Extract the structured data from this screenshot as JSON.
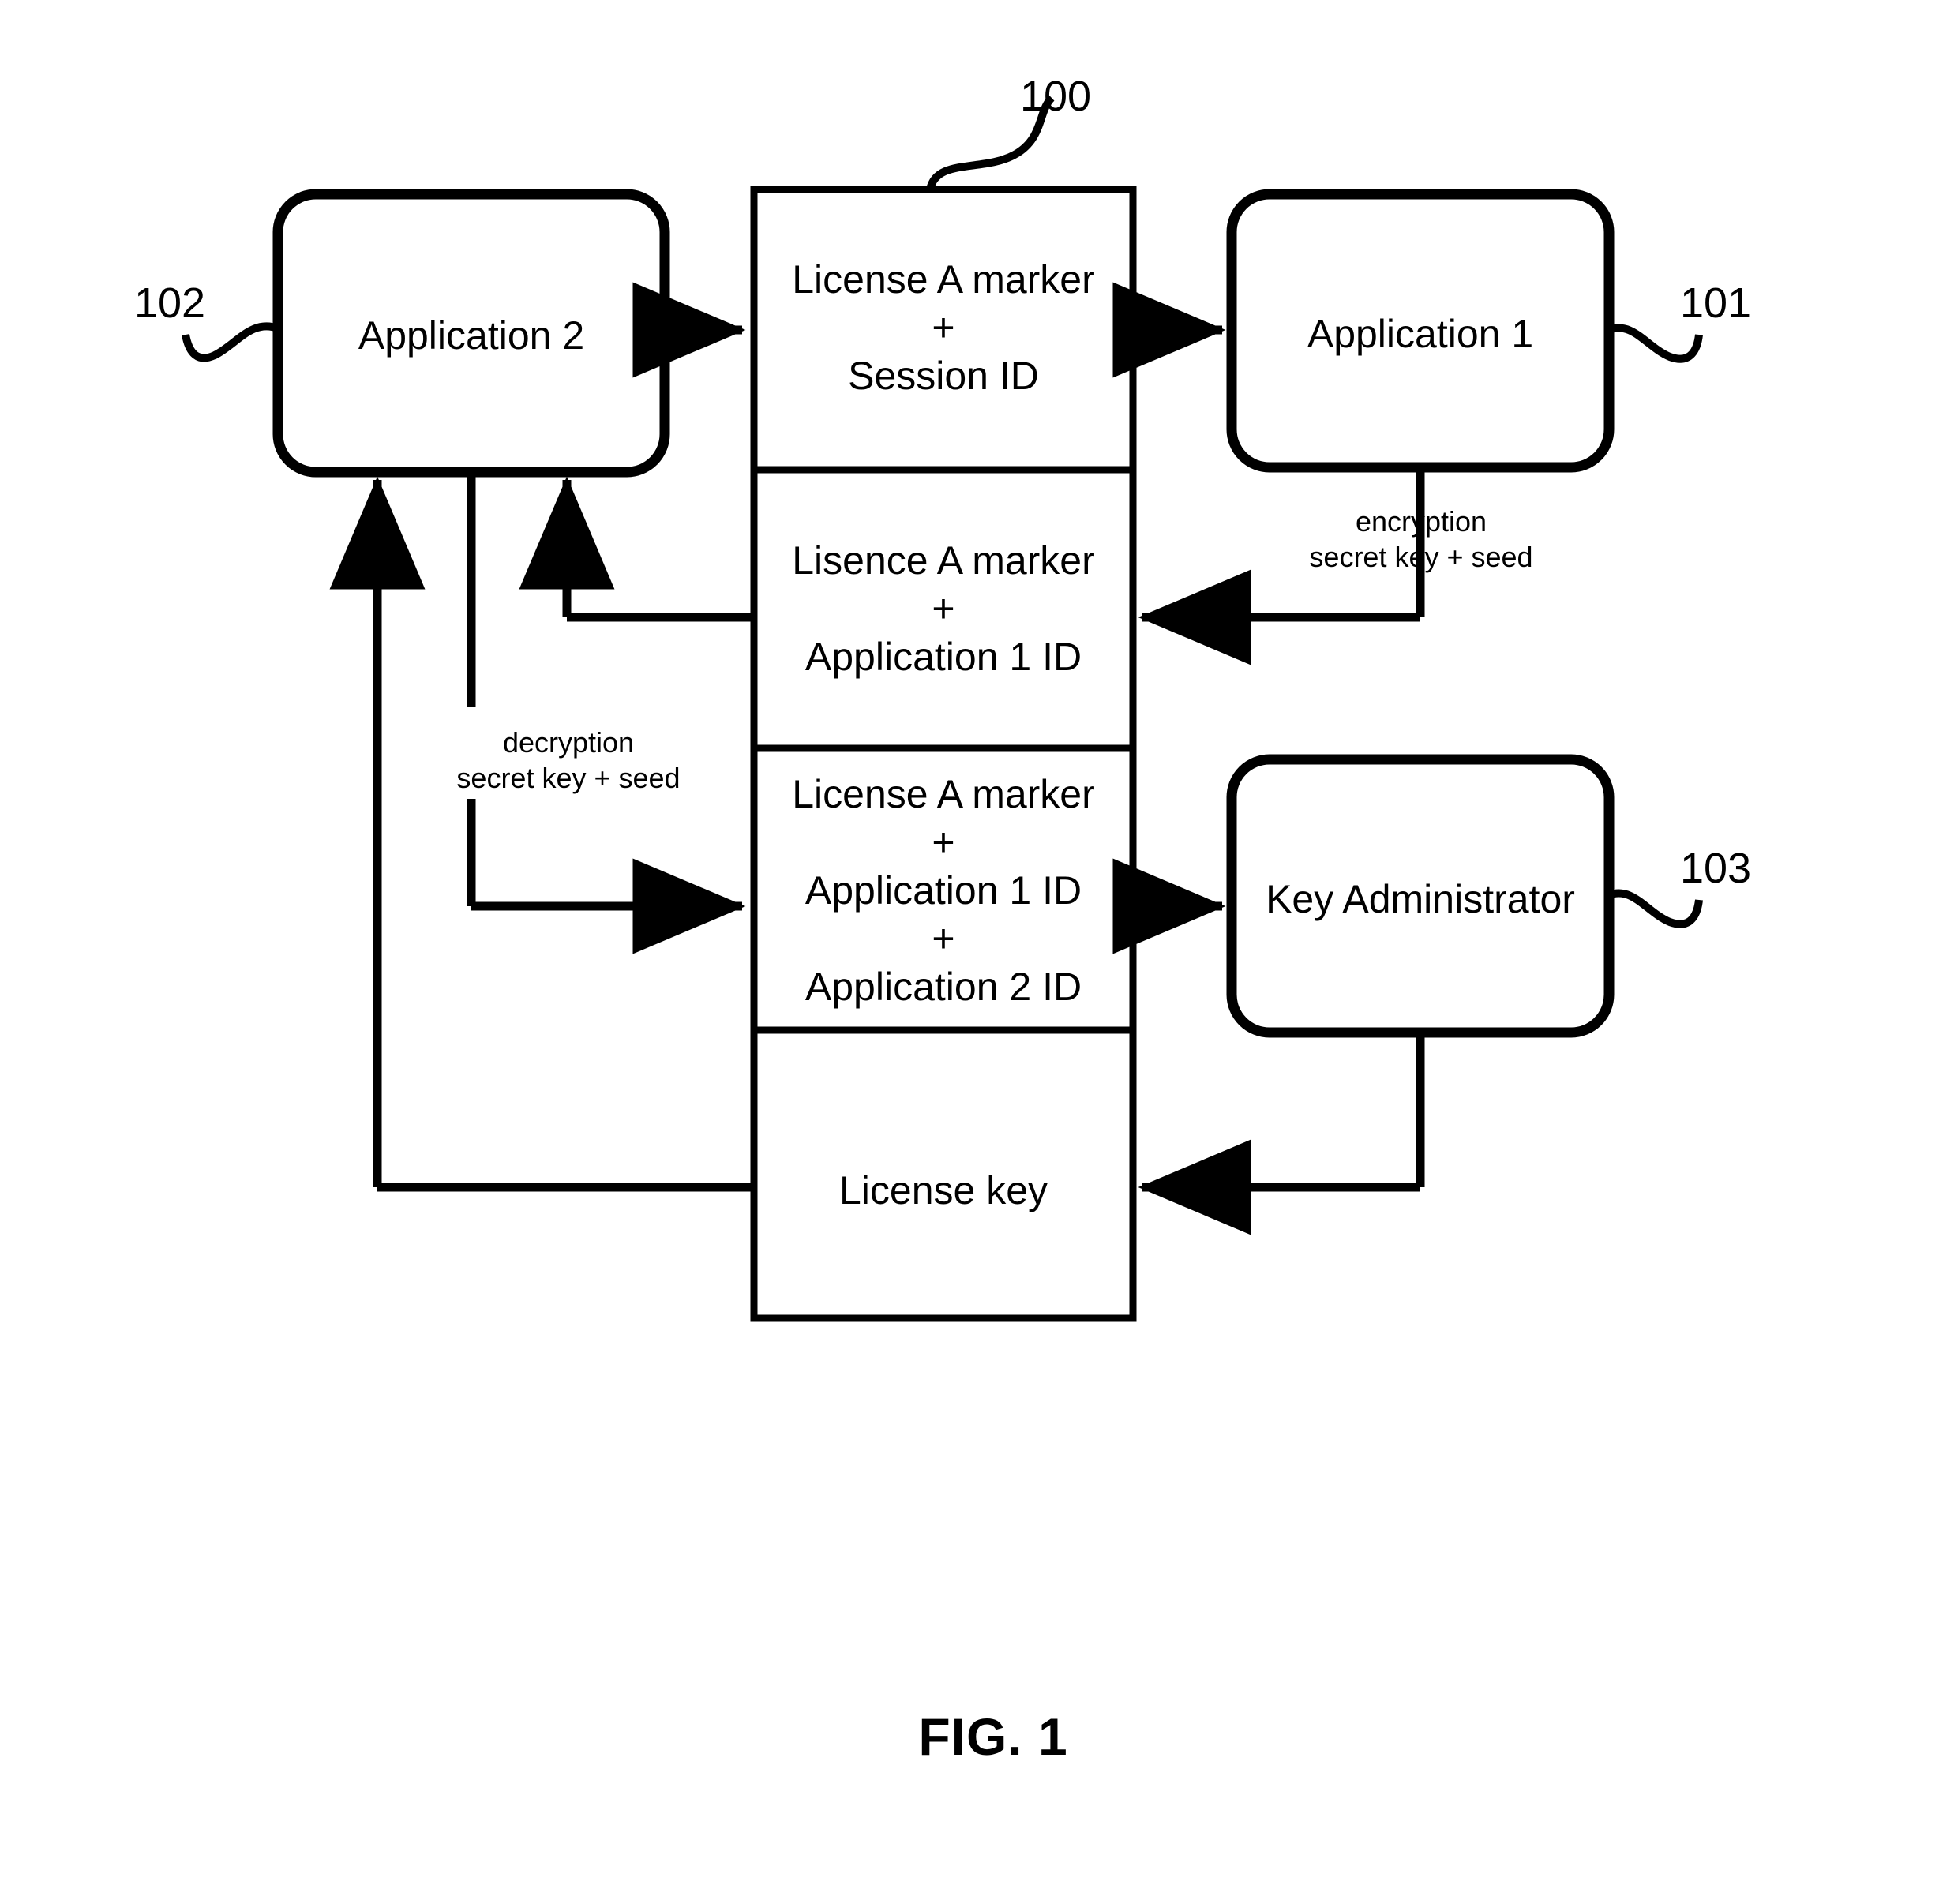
{
  "figure": {
    "caption": "FIG. 1",
    "reference_numerals": {
      "table": "100",
      "application_1": "101",
      "application_2": "102",
      "key_administrator": "103"
    }
  },
  "nodes": {
    "application_2": {
      "label": "Application 2",
      "ref": "102"
    },
    "application_1": {
      "label": "Application 1",
      "ref": "101"
    },
    "key_administrator": {
      "label": "Key Administrator",
      "ref": "103"
    }
  },
  "table": {
    "ref": "100",
    "rows": [
      {
        "lines": [
          "License A marker",
          "+",
          "Session ID"
        ]
      },
      {
        "lines": [
          "Lisence A marker",
          "+",
          "Application 1 ID"
        ]
      },
      {
        "lines": [
          "License A marker",
          "+",
          "Application 1 ID",
          "+",
          "Application 2 ID"
        ]
      },
      {
        "lines": [
          "License key"
        ]
      }
    ]
  },
  "annotations": {
    "encryption": {
      "lines": [
        "encryption",
        "secret key + seed"
      ]
    },
    "decryption": {
      "lines": [
        "decryption",
        "secret key + seed"
      ]
    }
  },
  "colors": {
    "stroke": "#000000",
    "background": "#ffffff"
  }
}
